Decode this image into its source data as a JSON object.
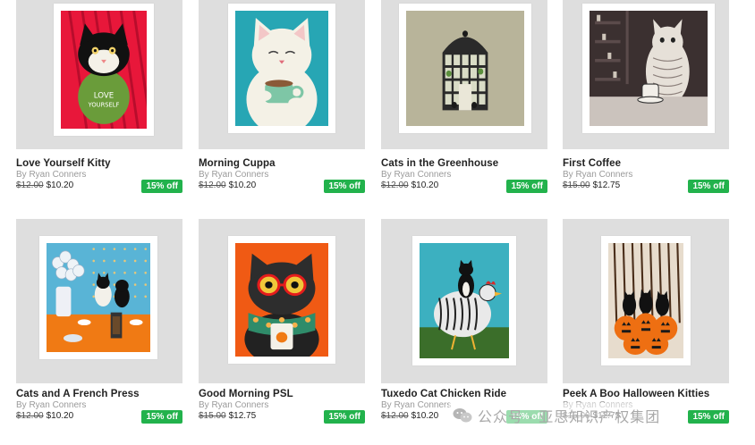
{
  "products": [
    {
      "title": "Love Yourself Kitty",
      "artist": "By Ryan Conners",
      "old_price": "$12.00",
      "new_price": "$10.20",
      "discount": "15% off",
      "art_icon": "tuxedo-cat-love-yourself-art",
      "colors": {
        "bg": "#e8173a",
        "accent": "#6a9c3a"
      }
    },
    {
      "title": "Morning Cuppa",
      "artist": "By Ryan Conners",
      "old_price": "$12.00",
      "new_price": "$10.20",
      "discount": "15% off",
      "art_icon": "white-cat-cup-art",
      "colors": {
        "bg": "#27a6b4",
        "accent": "#f4f1e6"
      }
    },
    {
      "title": "Cats in the Greenhouse",
      "artist": "By Ryan Conners",
      "old_price": "$12.00",
      "new_price": "$10.20",
      "discount": "15% off",
      "art_icon": "greenhouse-cats-art",
      "colors": {
        "bg": "#b8b49a",
        "accent": "#1e1e1e"
      }
    },
    {
      "title": "First Coffee",
      "artist": "By Ryan Conners",
      "old_price": "$15.00",
      "new_price": "$12.75",
      "discount": "15% off",
      "art_icon": "cat-first-coffee-art",
      "colors": {
        "bg": "#3b3030",
        "accent": "#e6e0d8"
      }
    },
    {
      "title": "Cats and A French Press",
      "artist": "By Ryan Conners",
      "old_price": "$12.00",
      "new_price": "$10.20",
      "discount": "15% off",
      "art_icon": "cats-french-press-art",
      "colors": {
        "bg": "#59b4d6",
        "accent": "#f07a14"
      }
    },
    {
      "title": "Good Morning PSL",
      "artist": "By Ryan Conners",
      "old_price": "$15.00",
      "new_price": "$12.75",
      "discount": "15% off",
      "art_icon": "cat-psl-glasses-art",
      "colors": {
        "bg": "#f05a14",
        "accent": "#2f8c6a"
      }
    },
    {
      "title": "Tuxedo Cat Chicken Ride",
      "artist": "By Ryan Conners",
      "old_price": "$12.00",
      "new_price": "$10.20",
      "discount": "15% off",
      "art_icon": "tuxedo-cat-chicken-art",
      "colors": {
        "bg": "#3cb0c0",
        "accent": "#3b6e2a"
      }
    },
    {
      "title": "Peek A Boo Halloween Kitties",
      "artist": "By Ryan Conners",
      "old_price": "$15.00",
      "new_price": "$12.75",
      "discount": "15% off",
      "art_icon": "halloween-kitties-pumpkins-art",
      "colors": {
        "bg": "#e7dccd",
        "accent": "#ee6f12"
      }
    }
  ],
  "watermark": {
    "text": "公众号 · 亚思知识产权集团",
    "icon": "wechat-icon"
  }
}
